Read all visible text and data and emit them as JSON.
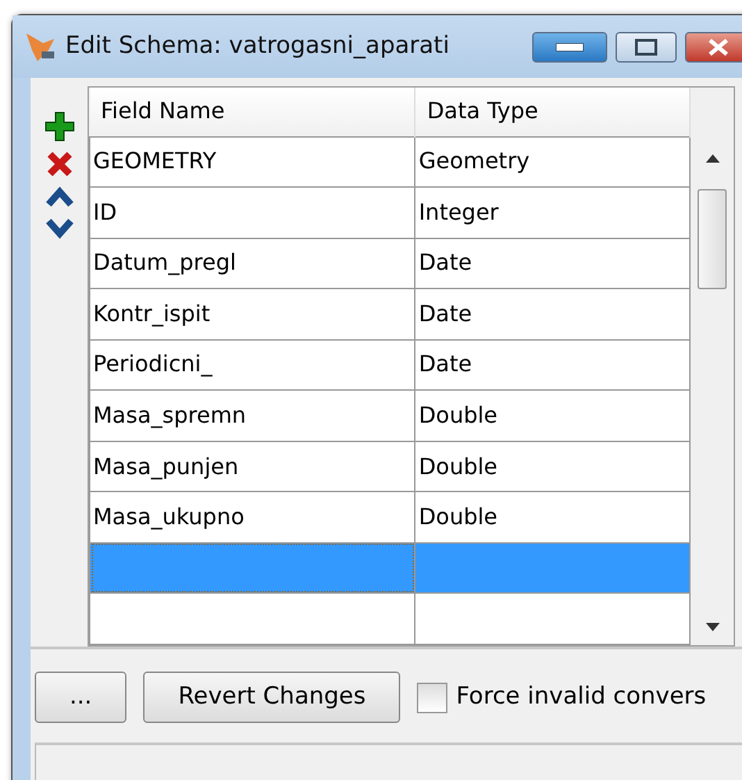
{
  "window": {
    "title": "Edit Schema: vatrogasni_aparati"
  },
  "table": {
    "columns": [
      "Field Name",
      "Data Type"
    ],
    "rows": [
      {
        "field_name": "GEOMETRY",
        "data_type": "Geometry",
        "selected": false
      },
      {
        "field_name": "ID",
        "data_type": "Integer",
        "selected": false
      },
      {
        "field_name": "Datum_pregl",
        "data_type": "Date",
        "selected": false
      },
      {
        "field_name": "Kontr_ispit",
        "data_type": "Date",
        "selected": false
      },
      {
        "field_name": "Periodicni_",
        "data_type": "Date",
        "selected": false
      },
      {
        "field_name": "Masa_spremn",
        "data_type": "Double",
        "selected": false
      },
      {
        "field_name": "Masa_punjen",
        "data_type": "Double",
        "selected": false
      },
      {
        "field_name": "Masa_ukupno",
        "data_type": "Double",
        "selected": false
      },
      {
        "selected": true
      },
      {
        "selected": false
      }
    ]
  },
  "buttons": [
    "...",
    "Revert Changes"
  ],
  "force_checkbox": {
    "label": "Force invalid convers",
    "checked": false
  }
}
